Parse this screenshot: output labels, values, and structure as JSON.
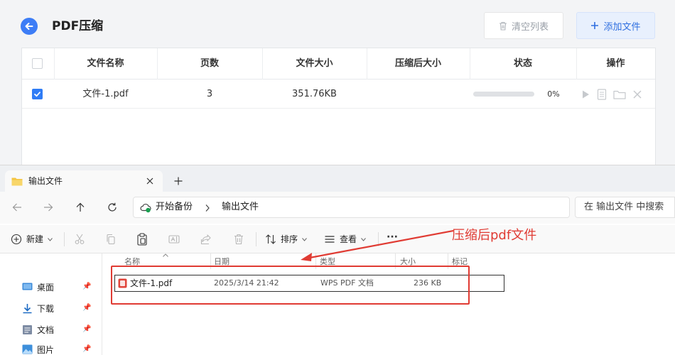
{
  "app": {
    "title": "PDF压缩",
    "clear_label": "清空列表",
    "add_label": "添加文件",
    "columns": [
      "文件名称",
      "页数",
      "文件大小",
      "压缩后大小",
      "状态",
      "操作"
    ],
    "row": {
      "checked": true,
      "name": "文件-1.pdf",
      "pages": "3",
      "size": "351.76KB",
      "compressed_size": "",
      "progress_text": "0%",
      "progress": 0
    },
    "accent_color": "#3d7df6"
  },
  "explorer": {
    "tab_title": "输出文件",
    "breadcrumb": [
      "开始备份",
      "输出文件"
    ],
    "search_placeholder": "在 输出文件 中搜索",
    "toolbar": {
      "new_label": "新建",
      "sort_label": "排序",
      "view_label": "查看",
      "more_label": "···"
    },
    "sidebar": [
      {
        "label": "桌面",
        "icon": "desktop-icon"
      },
      {
        "label": "下载",
        "icon": "download-icon"
      },
      {
        "label": "文档",
        "icon": "document-icon"
      },
      {
        "label": "图片",
        "icon": "picture-icon"
      }
    ],
    "columns": [
      "名称",
      "日期",
      "类型",
      "大小",
      "标记"
    ],
    "file": {
      "name": "文件-1.pdf",
      "date": "2025/3/14 21:42",
      "type": "WPS PDF 文档",
      "size": "236 KB"
    }
  },
  "annotation": {
    "text": "压缩后pdf文件",
    "color": "#e03b33"
  }
}
